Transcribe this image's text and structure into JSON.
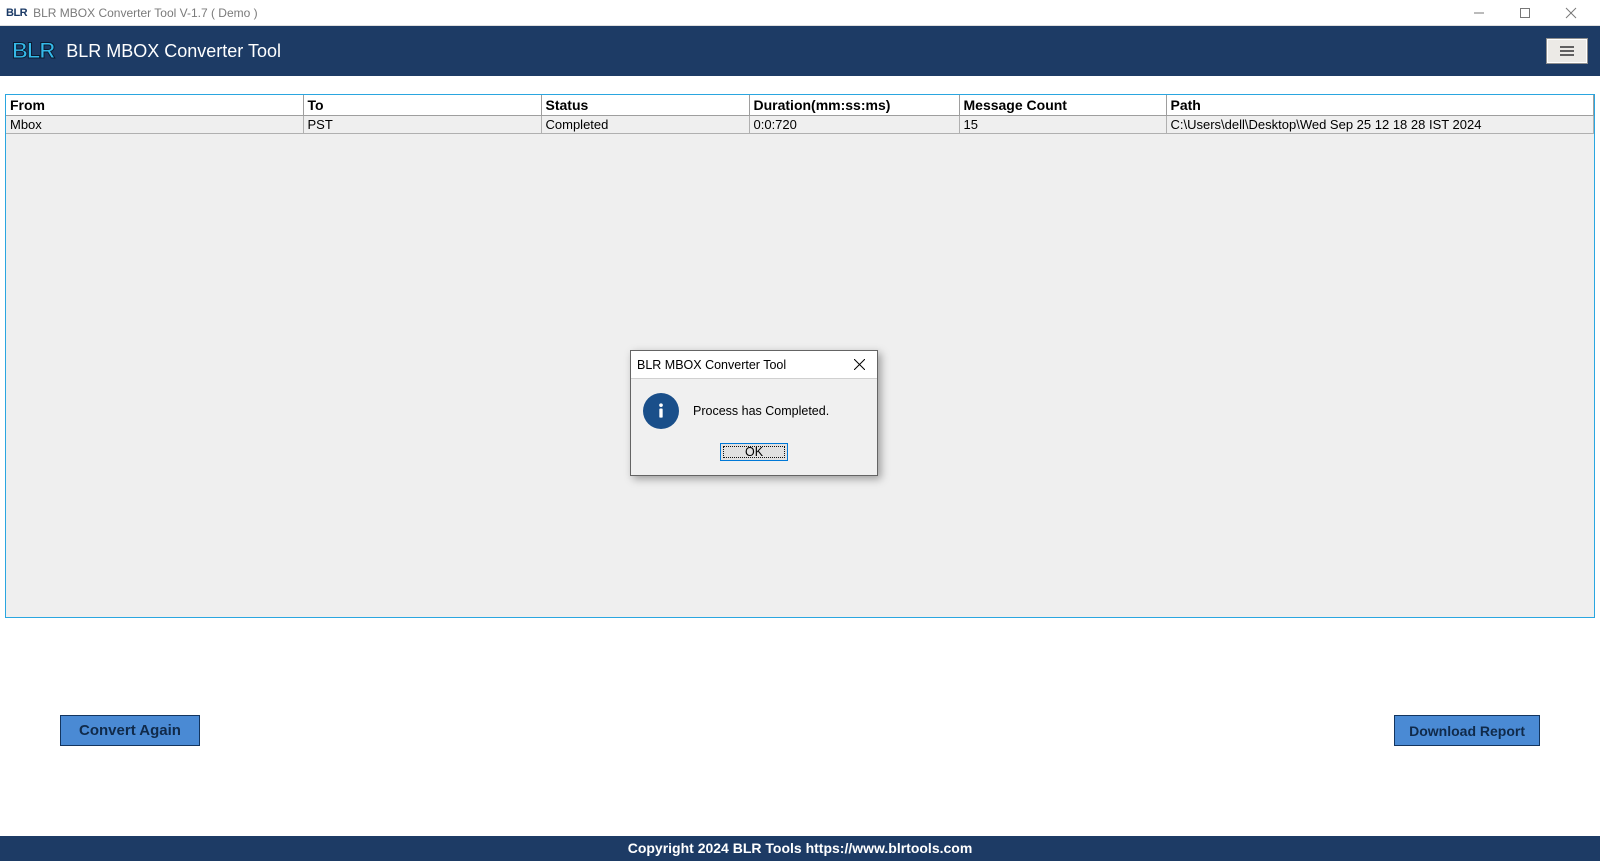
{
  "window": {
    "title": "BLR MBOX Converter Tool V-1.7 ( Demo )",
    "icon_text": "BLR"
  },
  "header": {
    "logo_text": "BLR",
    "app_title": "BLR MBOX Converter Tool"
  },
  "table": {
    "headers": {
      "from": "From",
      "to": "To",
      "status": "Status",
      "duration": "Duration(mm:ss:ms)",
      "count": "Message Count",
      "path": "Path"
    },
    "row": {
      "from": "Mbox",
      "to": "PST",
      "status": "Completed",
      "duration": "0:0:720",
      "count": "15",
      "path": "C:\\Users\\dell\\Desktop\\Wed Sep 25 12 18 28 IST 2024"
    }
  },
  "buttons": {
    "convert_again": "Convert Again",
    "download_report": "Download Report"
  },
  "dialog": {
    "title": "BLR MBOX Converter Tool",
    "message": "Process has Completed.",
    "ok": "OK"
  },
  "footer": {
    "copyright": "Copyright 2024 BLR Tools https://www.blrtools.com"
  }
}
